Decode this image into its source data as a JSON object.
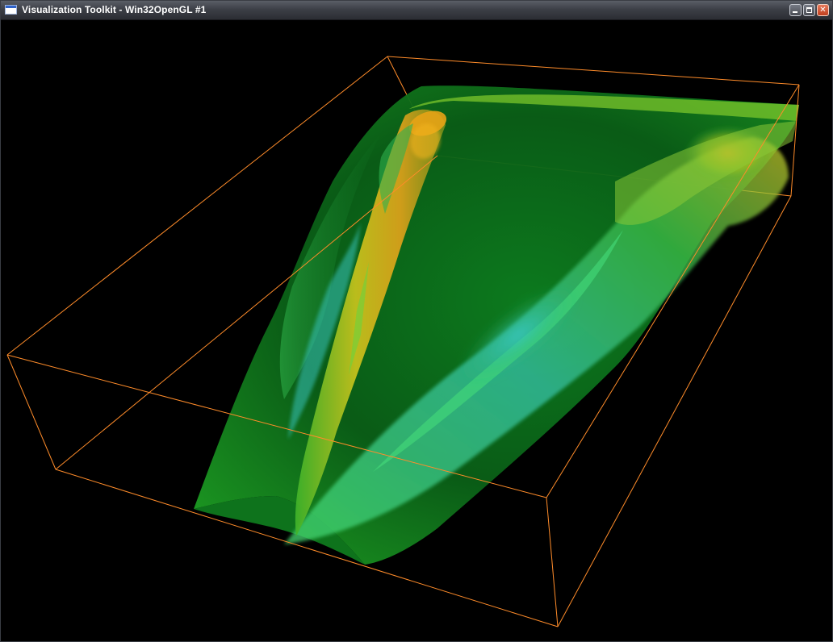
{
  "window": {
    "title": "Visualization Toolkit - Win32OpenGL #1",
    "icon": "vtk-window-icon",
    "controls": {
      "minimize": "minimize-icon",
      "maximize": "maximize-icon",
      "close": "close-icon"
    }
  },
  "scene": {
    "background_color": "#000000",
    "outline_color": "#ff8c2a",
    "surface_colors": [
      "#0b6a16",
      "#1ea52a",
      "#3fd35a",
      "#39c7b5",
      "#c6c51d",
      "#e0a21a"
    ]
  }
}
